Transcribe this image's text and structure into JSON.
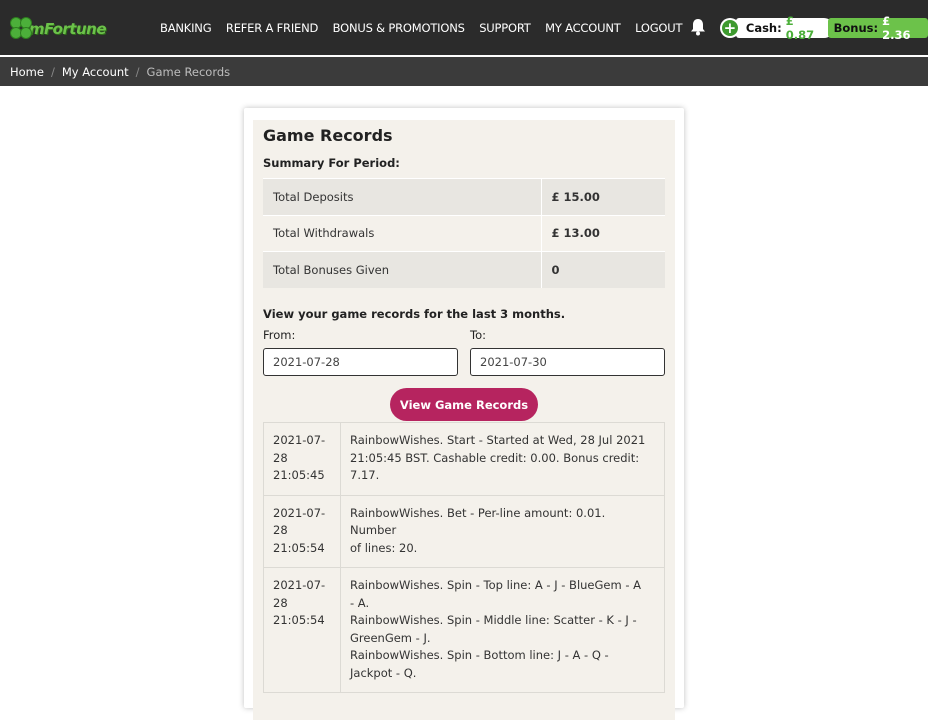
{
  "brand": {
    "logo_text": "mFortune"
  },
  "nav": {
    "items": [
      "BANKING",
      "REFER A FRIEND",
      "BONUS & PROMOTIONS",
      "SUPPORT",
      "MY ACCOUNT",
      "LOGOUT"
    ]
  },
  "wallet": {
    "cash_label": "Cash:",
    "cash_value": "£ 0.87",
    "bonus_label": "Bonus:",
    "bonus_value": "£ 2.36"
  },
  "breadcrumb": {
    "items": [
      "Home",
      "My Account"
    ],
    "current": "Game Records"
  },
  "page": {
    "title": "Game Records",
    "summary_heading": "Summary For Period:",
    "summary": [
      {
        "label": "Total Deposits",
        "value": "£ 15.00"
      },
      {
        "label": "Total Withdrawals",
        "value": "£ 13.00"
      },
      {
        "label": "Total Bonuses Given",
        "value": "0"
      }
    ],
    "period_text": "View your game records for the last 3 months.",
    "from_label": "From:",
    "to_label": "To:",
    "from_value": "2021-07-28",
    "to_value": "2021-07-30",
    "button_label": "View Game Records"
  },
  "records": [
    {
      "date_lines": [
        "2021-07-",
        "28",
        "21:05:45"
      ],
      "message_lines": [
        "RainbowWishes. Start - Started at Wed, 28 Jul 2021",
        "21:05:45 BST. Cashable credit: 0.00. Bonus credit: 7.17."
      ]
    },
    {
      "date_lines": [
        "2021-07-",
        "28",
        "21:05:54"
      ],
      "message_lines": [
        "RainbowWishes. Bet - Per-line amount: 0.01. Number",
        "of lines: 20."
      ]
    },
    {
      "date_lines": [
        "2021-07-",
        "28",
        "21:05:54"
      ],
      "message_lines": [
        "RainbowWishes. Spin - Top line: A - J - BlueGem - A",
        "- A.",
        "RainbowWishes. Spin - Middle line: Scatter - K - J -",
        "GreenGem - J.",
        "RainbowWishes. Spin - Bottom line: J - A - Q -",
        "Jackpot - Q."
      ]
    }
  ]
}
